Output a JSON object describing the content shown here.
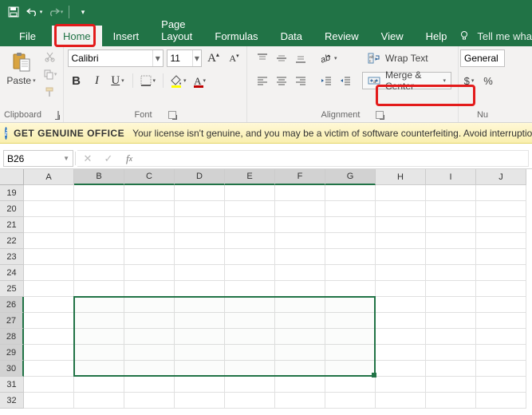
{
  "tabs": {
    "file": "File",
    "home": "Home",
    "insert": "Insert",
    "pagelayout": "Page Layout",
    "formulas": "Formulas",
    "data": "Data",
    "review": "Review",
    "view": "View",
    "help": "Help",
    "tellme": "Tell me wha"
  },
  "ribbon": {
    "clipboard": {
      "label": "Clipboard",
      "paste": "Paste"
    },
    "font": {
      "label": "Font",
      "name": "Calibri",
      "size": "11"
    },
    "alignment": {
      "label": "Alignment",
      "wrap": "Wrap Text",
      "merge": "Merge & Center"
    },
    "number": {
      "label": "Nu",
      "format": "General"
    }
  },
  "warning": {
    "title": "GET GENUINE OFFICE",
    "msg": "Your license isn't genuine, and you may be a victim of software counterfeiting. Avoid interruptio"
  },
  "namebox": "B26",
  "formula": "",
  "columns": [
    "A",
    "B",
    "C",
    "D",
    "E",
    "F",
    "G",
    "H",
    "I",
    "J"
  ],
  "rows": [
    "19",
    "20",
    "21",
    "22",
    "23",
    "24",
    "25",
    "26",
    "27",
    "28",
    "29",
    "30",
    "31",
    "32"
  ],
  "selected_cols": [
    "B",
    "C",
    "D",
    "E",
    "F",
    "G"
  ],
  "selected_rows": [
    "26",
    "27",
    "28",
    "29",
    "30"
  ]
}
